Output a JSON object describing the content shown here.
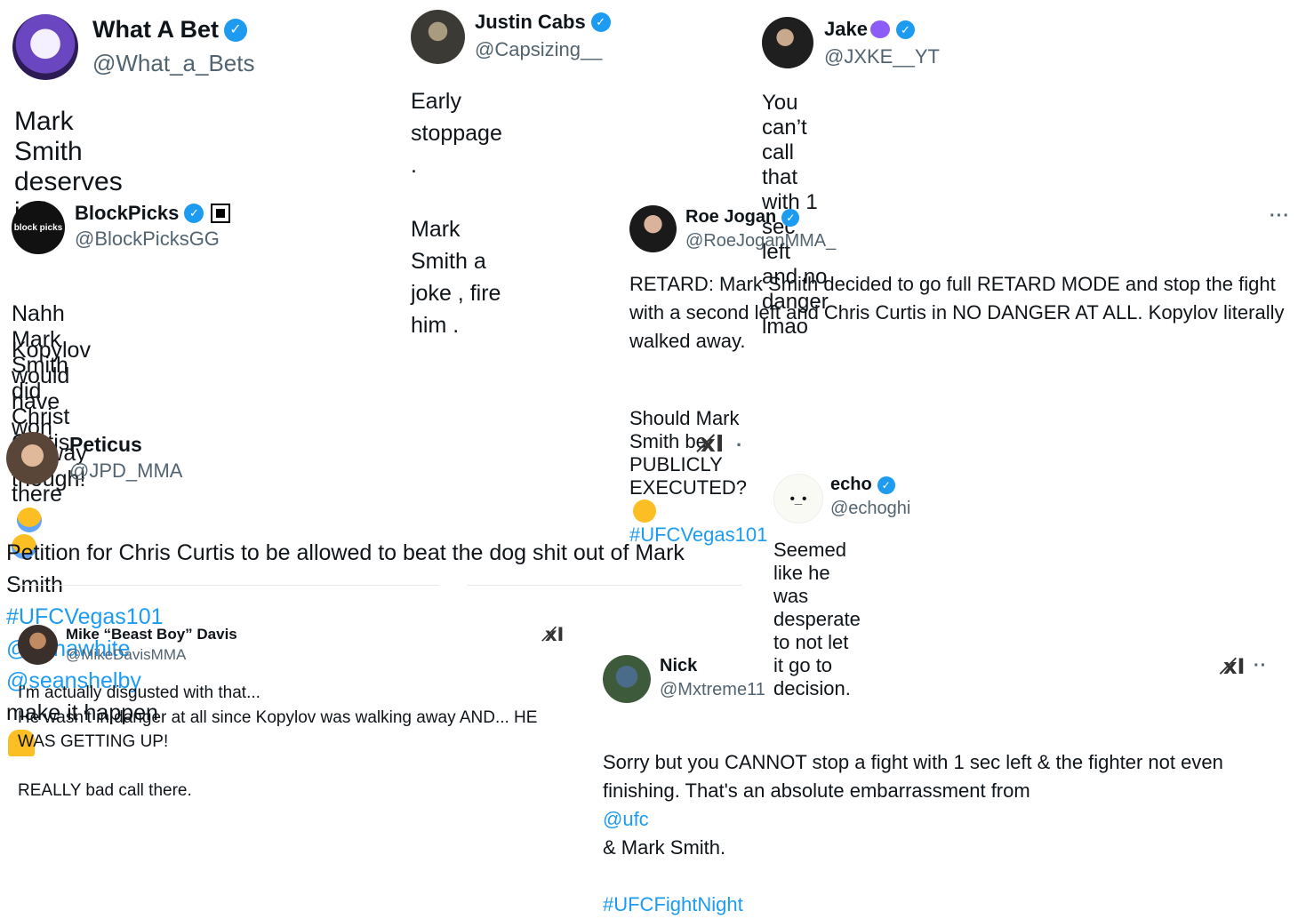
{
  "tweets": [
    {
      "name": "What A Bet",
      "handle": "@What_a_Bets",
      "text": "Mark Smith deserves jail."
    },
    {
      "name": "Justin Cabs",
      "handle": "@Capsizing__",
      "text": "Early stoppage .\n\nMark Smith a joke , fire him ."
    },
    {
      "name": "Jake",
      "handle": "@JXKE__YT",
      "text": "You can’t call that with 1 sec left and no danger lmao"
    },
    {
      "name": "BlockPicks",
      "handle": "@BlockPicksGG",
      "text_l1": "Nahh Mark Smith did Christ Curtis dirty there",
      "text_l2": "Kopylov would have won anyway though!"
    },
    {
      "name": "Roe Jogan",
      "handle": "@RoeJoganMMA_",
      "text_main": "RETARD: Mark Smith decided to go full RETARD MODE and stop the fight with a second left and Chris Curtis in NO DANGER AT ALL. Kopylov literally walked away.",
      "text_q": "Should Mark Smith be PUBLICLY EXECUTED?",
      "hashtag": "#UFCVegas101",
      "more": "···"
    },
    {
      "name": "Peticus",
      "handle": "@JPD_MMA",
      "text_a": "Petition for Chris Curtis to be allowed to beat the dog shit out of Mark Smith",
      "tag1": "#UFCVegas101",
      "tag2": "@danawhite",
      "tag3": "@seanshelby",
      "text_b": "make it happen",
      "logo": "x̸I",
      "dot": "·"
    },
    {
      "name": "echo",
      "handle": "@echoghi",
      "text": "Seemed like he was desperate to not let it go to decision.",
      "avatar_text": "•_•"
    },
    {
      "name": "Mike “Beast Boy” Davis",
      "handle": "@MikeDavisMMA",
      "text": "I'm actually disgusted with that...\nHe wasn't in danger at all since Kopylov was walking away AND... HE WAS GETTING UP!\n\nREALLY bad call there.",
      "logo": "x̸I"
    },
    {
      "name": "Nick",
      "handle": "@Mxtreme11",
      "text_a": "Sorry but you CANNOT stop a fight with 1 sec left & the fighter not even finishing. That's an absolute embarrassment from",
      "mention": "@ufc",
      "text_b": "& Mark Smith.",
      "hashtag": "#UFCFightNight",
      "logo": "x̸I",
      "more": "··"
    }
  ],
  "badge_glyph": "✓",
  "avatar_brand": "block picks",
  "icons": {
    "verified": "verified-badge-icon",
    "crying": "loudly-crying-face-emoji",
    "sweat": "grinning-sweat-emoji",
    "pray": "folded-hands-emoji",
    "devil": "smiling-devil-emoji"
  },
  "colors": {
    "link": "#1d9bf0",
    "text": "#0f1419",
    "handle": "#536471"
  }
}
